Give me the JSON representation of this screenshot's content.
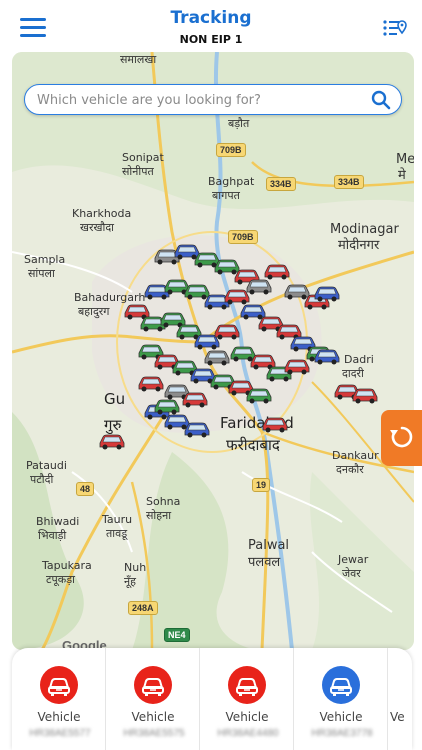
{
  "header": {
    "title": "Tracking",
    "subtitle": "NON EIP 1"
  },
  "search": {
    "placeholder": "Which vehicle are you looking for?"
  },
  "map": {
    "labels": {
      "samalkha": "समालखा",
      "badaut": "बड़ौत",
      "sonipat_en": "Sonipat",
      "sonipat_hi": "सोनीपत",
      "baghpat_en": "Baghpat",
      "baghpat_hi": "बागपत",
      "kharkhoda_en": "Kharkhoda",
      "kharkhoda_hi": "खरखौदा",
      "modinagar_en": "Modinagar",
      "modinagar_hi": "मोदीनगर",
      "sampla_en": "Sampla",
      "sampla_hi": "सांपला",
      "bahadurgarh_en": "Bahadurgarh",
      "bahadurgarh_hi": "बहादुरग",
      "dadri_en": "Dadri",
      "dadri_hi": "दादरी",
      "gurgaon_en": "Gu",
      "gurgaon_hi": "गुरु",
      "faridabad_en": "Faridabad",
      "faridabad_hi": "फरीदाबाद",
      "dankaur_en": "Dankaur",
      "dankaur_hi": "दनकौर",
      "pataudi_en": "Pataudi",
      "pataudi_hi": "पटौदी",
      "sohna_en": "Sohna",
      "sohna_hi": "सोहना",
      "bhiwadi_en": "Bhiwadi",
      "bhiwadi_hi": "भिवाड़ी",
      "tauru_en": "Tauru",
      "tauru_hi": "तावडू",
      "palwal_en": "Palwal",
      "palwal_hi": "पलवल",
      "tapukara_en": "Tapukara",
      "tapukara_hi": "टपूकड़ा",
      "nuh_en": "Nuh",
      "nuh_hi": "नूँह",
      "jewar_en": "Jewar",
      "jewar_hi": "जेवर",
      "me_en": "Me",
      "me_hi": "मे"
    },
    "shields": {
      "s709b_1": "709B",
      "s334b_1": "334B",
      "s334b_2": "334B",
      "s709b_2": "709B",
      "s48": "48",
      "s19": "19",
      "s248a": "248A",
      "sne4": "NE4"
    },
    "attribution": "Google"
  },
  "vehicles": [
    {
      "label": "Vehicle",
      "plate": "HR38AE5577",
      "status_color": "#e8231a"
    },
    {
      "label": "Vehicle",
      "plate": "HR38AE5575",
      "status_color": "#e8231a"
    },
    {
      "label": "Vehicle",
      "plate": "HR38AE4480",
      "status_color": "#e8231a"
    },
    {
      "label": "Vehicle",
      "plate": "HR38AE3778",
      "status_color": "#2a6fdb"
    },
    {
      "label": "Ve",
      "plate": "",
      "status_color": "#e8231a"
    }
  ],
  "colors": {
    "accent": "#1a6fd0",
    "refresh": "#f07a26",
    "car_red": "#d63a3a",
    "car_green": "#3d9a4a",
    "car_blue": "#3b5fc8",
    "car_gray": "#8c8c8c"
  }
}
